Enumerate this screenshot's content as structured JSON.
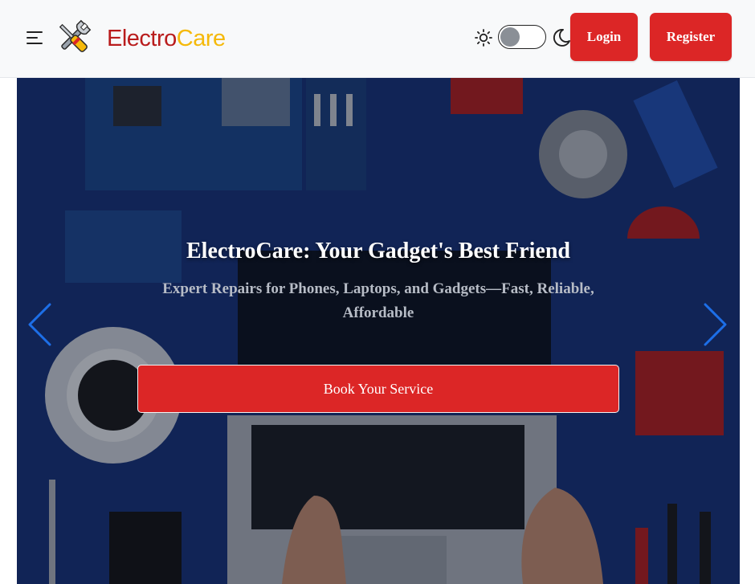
{
  "navbar": {
    "brand_part1": "Electro",
    "brand_part2": "Care",
    "login_label": "Login",
    "register_label": "Register",
    "theme": "light"
  },
  "hero": {
    "title": "ElectroCare: Your Gadget's Best Friend",
    "subtitle": "Expert Repairs for Phones, Laptops, and Gadgets—Fast, Reliable, Affordable",
    "cta_label": "Book Your Service"
  },
  "icons": {
    "menu": "hamburger-menu-icon",
    "logo": "wrench-screwdriver-icon",
    "light": "sun-icon",
    "dark": "moon-icon",
    "prev": "chevron-left-icon",
    "next": "chevron-right-icon"
  },
  "colors": {
    "brand_red": "#b91c1c",
    "brand_yellow": "#f5b90a",
    "button_red": "#dc2626",
    "arrow_blue": "#1d6fe8",
    "hero_blue": "#15306a"
  }
}
